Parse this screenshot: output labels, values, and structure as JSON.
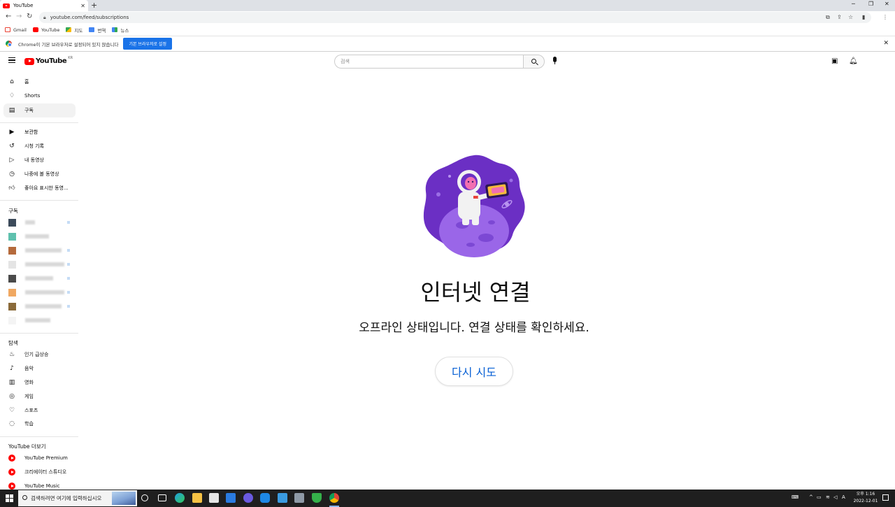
{
  "browser": {
    "tab_title": "YouTube",
    "url": "youtube.com/feed/subscriptions",
    "bookmarks": [
      "Gmail",
      "YouTube",
      "지도",
      "번역",
      "뉴스"
    ],
    "infobar_text": "Chrome이 기본 브라우저로 설정되어 있지 않습니다",
    "infobar_button": "기본 브라우저로 설정"
  },
  "header": {
    "logo_text": "YouTube",
    "region": "KR",
    "search_placeholder": "검색"
  },
  "sidebar": {
    "main": [
      {
        "label": "홈",
        "icon": "home-icon"
      },
      {
        "label": "Shorts",
        "icon": "shorts-icon"
      },
      {
        "label": "구독",
        "icon": "subscriptions-icon",
        "active": true
      }
    ],
    "library": [
      {
        "label": "보관함",
        "icon": "library-icon"
      },
      {
        "label": "시청 기록",
        "icon": "history-icon"
      },
      {
        "label": "내 동영상",
        "icon": "my-videos-icon"
      },
      {
        "label": "나중에 볼 동영상",
        "icon": "watch-later-icon"
      },
      {
        "label": "좋아요 표시한 동영...",
        "icon": "liked-icon"
      }
    ],
    "subs_heading": "구독",
    "explore_heading": "탐색",
    "explore": [
      {
        "label": "인기 급상승",
        "icon": "trending-icon"
      },
      {
        "label": "음악",
        "icon": "music-icon"
      },
      {
        "label": "영화",
        "icon": "movies-icon"
      },
      {
        "label": "게임",
        "icon": "gaming-icon"
      },
      {
        "label": "스포츠",
        "icon": "sports-icon"
      },
      {
        "label": "학습",
        "icon": "learning-icon"
      }
    ],
    "more_heading": "YouTube 더보기",
    "more": [
      {
        "label": "YouTube Premium"
      },
      {
        "label": "크리에이터 스튜디오"
      },
      {
        "label": "YouTube Music"
      }
    ]
  },
  "main": {
    "title": "인터넷 연결",
    "message": "오프라인 상태입니다. 연결 상태를 확인하세요.",
    "retry_label": "다시 시도"
  },
  "taskbar": {
    "search_placeholder": "검색하려면 여기에 입력하십시오",
    "time": "오후 1:16",
    "date": "2022-12-01"
  },
  "colors": {
    "youtube_red": "#ff0000",
    "link_blue": "#065fd4",
    "chrome_blue": "#1a73e8"
  }
}
